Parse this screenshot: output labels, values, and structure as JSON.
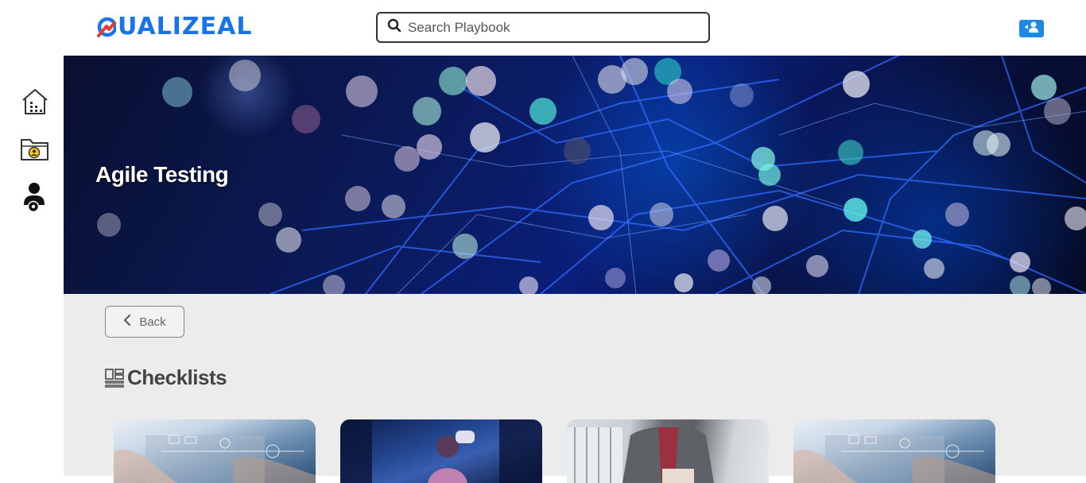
{
  "header": {
    "logo_text": "UALIZEAL",
    "search": {
      "placeholder": "Search Playbook",
      "value": ""
    },
    "user_button_icon": "user-switch-icon"
  },
  "sidebar": {
    "items": [
      {
        "name": "dashboard",
        "icon": "building-icon"
      },
      {
        "name": "playbook-folder",
        "icon": "folder-user-icon"
      },
      {
        "name": "admin-settings",
        "icon": "user-gear-icon"
      }
    ]
  },
  "hero": {
    "title": "Agile Testing"
  },
  "main": {
    "back_label": "Back",
    "section_title": "Checklists",
    "section_icon": "layout-icon",
    "cards": [
      {
        "name": "checklist-card-1"
      },
      {
        "name": "checklist-card-2"
      },
      {
        "name": "checklist-card-3"
      },
      {
        "name": "checklist-card-4"
      }
    ]
  },
  "colors": {
    "brand_blue": "#1a73e8",
    "brand_red": "#e53935",
    "accent_button": "#1e88e5",
    "content_bg": "#ececec",
    "title_text": "#444444"
  }
}
